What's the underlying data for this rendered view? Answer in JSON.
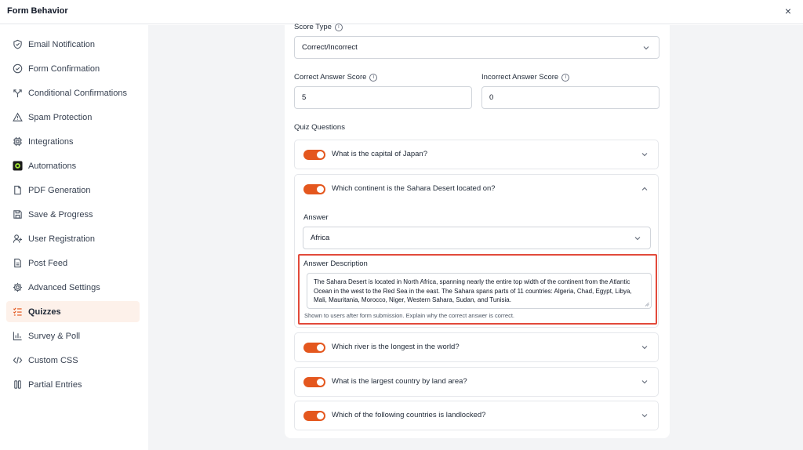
{
  "window": {
    "title": "Form Behavior",
    "close_label": "×"
  },
  "sidebar": {
    "items": [
      {
        "label": "Email Notification",
        "icon": "shield-check-icon"
      },
      {
        "label": "Form Confirmation",
        "icon": "circle-check-icon"
      },
      {
        "label": "Conditional Confirmations",
        "icon": "branch-icon"
      },
      {
        "label": "Spam Protection",
        "icon": "warning-icon"
      },
      {
        "label": "Integrations",
        "icon": "chip-icon"
      },
      {
        "label": "Automations",
        "icon": "automation-icon"
      },
      {
        "label": "PDF Generation",
        "icon": "file-icon"
      },
      {
        "label": "Save & Progress",
        "icon": "save-icon"
      },
      {
        "label": "User Registration",
        "icon": "user-plus-icon"
      },
      {
        "label": "Post Feed",
        "icon": "document-icon"
      },
      {
        "label": "Advanced Settings",
        "icon": "gear-icon"
      },
      {
        "label": "Quizzes",
        "icon": "quiz-list-icon",
        "active": true
      },
      {
        "label": "Survey & Poll",
        "icon": "bar-chart-icon"
      },
      {
        "label": "Custom CSS",
        "icon": "code-icon"
      },
      {
        "label": "Partial Entries",
        "icon": "columns-icon"
      }
    ]
  },
  "quiz": {
    "score_type": {
      "label": "Score Type",
      "value": "Correct/Incorrect"
    },
    "correct_score": {
      "label": "Correct Answer Score",
      "value": "5"
    },
    "incorrect_score": {
      "label": "Incorrect Answer Score",
      "value": "0"
    },
    "questions_label": "Quiz Questions",
    "questions": [
      {
        "text": "What is the capital of Japan?",
        "enabled": true
      },
      {
        "text": "Which continent is the Sahara Desert located on?",
        "enabled": true
      },
      {
        "text": "Which river is the longest in the world?",
        "enabled": true
      },
      {
        "text": "What is the largest country by land area?",
        "enabled": true
      },
      {
        "text": "Which of the following countries is landlocked?",
        "enabled": true
      }
    ],
    "expanded": {
      "answer_label": "Answer",
      "answer_value": "Africa",
      "description_label": "Answer Description",
      "description_value": "The Sahara Desert is located in North Africa, spanning nearly the entire top width of the continent from the Atlantic Ocean in the west to the Red Sea in the east. The Sahara spans parts of 11 countries: Algeria, Chad, Egypt, Libya, Mali, Mauritania, Morocco, Niger, Western Sahara, Sudan, and Tunisia.",
      "description_hint": "Shown to users after form submission. Explain why the correct answer is correct."
    }
  },
  "colors": {
    "accent": "#e4571e",
    "highlight": "#e24a3b",
    "active_bg": "#fdf1ea"
  }
}
